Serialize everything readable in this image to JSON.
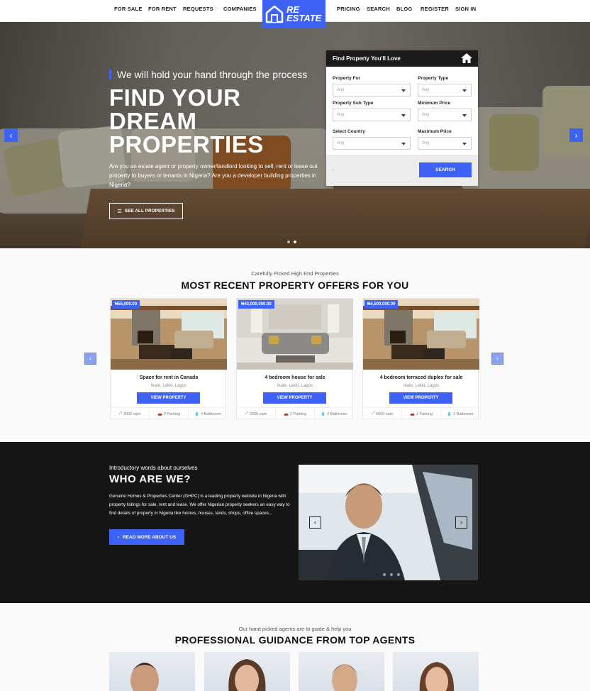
{
  "nav": {
    "left": [
      "FOR SALE",
      "FOR RENT",
      "REQUESTS",
      "COMPANIES"
    ],
    "separator": "-",
    "right": [
      "PRICING",
      "SEARCH",
      "BLOG",
      "REGISTER",
      "SIGN IN"
    ],
    "logo_line1": "RE",
    "logo_line2": "ESTATE"
  },
  "hero": {
    "tagline": "We will hold your hand through the process",
    "headline_1": "FIND YOUR",
    "headline_2": "DREAM",
    "headline_3": "PROPERTIES",
    "description": "Are you an estate agent or property owner/landlord looking to sell, rent or lease out property to buyers or tenants in Nigeria? Are you a developer building properties in Nigeria?",
    "cta": "SEE ALL PROPERTIES",
    "prev_arrow": "‹",
    "next_arrow": "›",
    "slide_count": 2,
    "active_slide": 2
  },
  "search_form": {
    "title": "Find Property You'll Love",
    "fields": {
      "property_for": {
        "label": "Property For",
        "value": "Any"
      },
      "property_type": {
        "label": "Property Type",
        "value": "Any"
      },
      "property_sub_type": {
        "label": "Property Sub Type",
        "value": "Any"
      },
      "minimum_price": {
        "label": "Minimum Price",
        "value": "Any"
      },
      "select_country": {
        "label": "Select Country",
        "value": "Any"
      },
      "maximum_price": {
        "label": "Maximum Price",
        "value": "Any"
      }
    },
    "advanced_link": "-",
    "button": "SEARCH"
  },
  "offers": {
    "subtitle": "Carefully Picked High End Properties",
    "title": "MOST RECENT PROPERTY OFFERS FOR YOU",
    "prev": "‹",
    "next": "›",
    "cards": [
      {
        "price": "₦55,000.00",
        "title": "Space for rent in Canada",
        "location": "Ikate, Lekki, Lagos",
        "button": "VIEW PROPERTY",
        "area": "3000 sqm",
        "parking": "0 Parking",
        "bathroom": "4 Bathroom"
      },
      {
        "price": "₦43,000,000.00",
        "title": "4 bedroom house for sale",
        "location": "Ikate, Lekki, Lagos",
        "button": "VIEW PROPERTY",
        "area": "6000 sqm",
        "parking": "1 Parking",
        "bathroom": "2 Bathroom"
      },
      {
        "price": "₦5,500,000.00",
        "title": "4 bedroom terraced duplex for sale",
        "location": "Ikate, Lekki, Lagos",
        "button": "VIEW PROPERTY",
        "area": "6000 sqm",
        "parking": "1 Parking",
        "bathroom": "2 Bathroom"
      }
    ]
  },
  "about": {
    "subtitle": "Introductory words about ourselves",
    "title": "WHO ARE WE?",
    "text": "Genuine Homes & Properties Center (GHPC) is a leading property website in Nigeria with property listings for sale, rent and lease. We offer Nigerian property seekers an easy way to find details of property in Nigeria like homes, houses, lands, shops, office spaces...",
    "button": "READ MORE ABOUT US",
    "prev": "‹",
    "next": "›",
    "slide_count": 4,
    "active_slide": 1
  },
  "agents": {
    "subtitle": "Our hand picked agents are to guide & help you",
    "title": "PROFESSIONAL GUIDANCE FROM TOP AGENTS"
  },
  "colors": {
    "accent": "#3d62f5",
    "dark": "#161616"
  }
}
